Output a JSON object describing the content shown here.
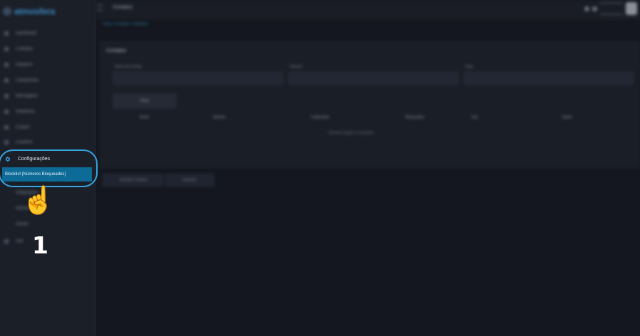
{
  "app": {
    "logo_text": "atmosfera"
  },
  "topbar": {
    "title": "Contatos"
  },
  "breadcrumb": {
    "text": "Home / Contatos / Cadastrar"
  },
  "sidebar": {
    "items": [
      {
        "label": "Dashboard"
      },
      {
        "label": "Contatos"
      },
      {
        "label": "Disparos"
      },
      {
        "label": "Campanhas"
      },
      {
        "label": "Mensagens"
      },
      {
        "label": "Relatórios"
      },
      {
        "label": "Grupos"
      },
      {
        "label": "Usuários"
      }
    ],
    "config_label": "Configurações",
    "submenu_selected": "Blocklist (Números Bloqueados)",
    "below_items": [
      {
        "label": "Integrações"
      },
      {
        "label": "Webhooks"
      },
      {
        "label": "Gerais"
      }
    ],
    "last_item": "Sair"
  },
  "panel": {
    "title": "Contatos",
    "fields": [
      {
        "label": "Nome do contato"
      },
      {
        "label": "Número"
      },
      {
        "label": "Data"
      }
    ],
    "filter_button": "Filtrar",
    "table_headers": [
      "Nome",
      "Número",
      "Cadastrado",
      "Bloqueados",
      "Tipo",
      "Ações"
    ],
    "empty_text": "Nenhum registro encontrado"
  },
  "actions": {
    "import_button": "Importar contatos",
    "export_button": "Exportar"
  },
  "annotation": {
    "step_number": "1"
  },
  "colors": {
    "accent": "#37a4e0",
    "selected": "#0e6b98",
    "background": "#14171f"
  }
}
